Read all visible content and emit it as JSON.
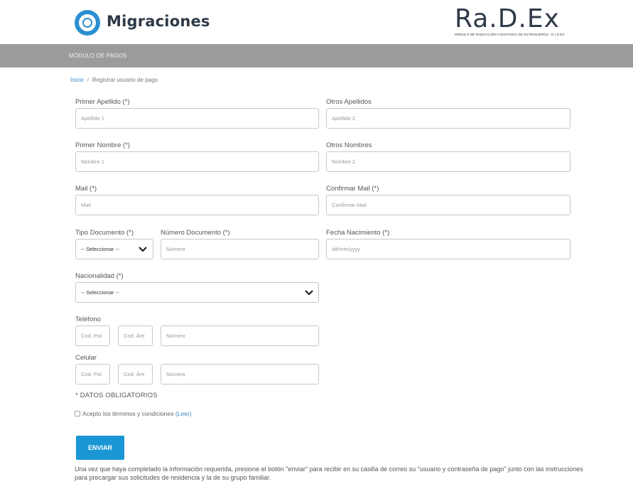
{
  "header": {
    "brand": "Migraciones",
    "radex_logo": "Ra.D.Ex",
    "radex_subtitle": "MÓDULO DE RADICACIÓN A DISTANCIA DE EXTRANJEROS - D.I.D.EX"
  },
  "section_bar": {
    "title": "MÓDULO DE PAGOS"
  },
  "breadcrumb": {
    "home": "Inicio",
    "separator": "/",
    "current": "Registrar usuario de pago"
  },
  "form": {
    "primer_apellido": {
      "label": "Primer Apellido (*)",
      "placeholder": "Apellido 1"
    },
    "otros_apellidos": {
      "label": "Otros Apellidos",
      "placeholder": "Apellido 2"
    },
    "primer_nombre": {
      "label": "Primer Nombre (*)",
      "placeholder": "Nombre 1"
    },
    "otros_nombres": {
      "label": "Otros Nombres",
      "placeholder": "Nombre 2"
    },
    "mail": {
      "label": "Mail (*)",
      "placeholder": "Mail"
    },
    "confirmar_mail": {
      "label": "Confirmar Mail (*)",
      "placeholder": "Confirmar Mail"
    },
    "tipo_documento": {
      "label": "Tipo Documento (*)",
      "value": "-- Seleccionar --"
    },
    "numero_documento": {
      "label": "Número Documento (*)",
      "placeholder": "Número"
    },
    "fecha_nacimiento": {
      "label": "Fecha Nacimiento (*)",
      "placeholder": "dd/mm/yyyy"
    },
    "nacionalidad": {
      "label": "Nacionalidad (*)",
      "value": "-- Seleccionar --"
    },
    "telefono": {
      "label": "Teléfono",
      "pais": "Cod. Paí",
      "area": "Cod. Áre",
      "numero": "Número"
    },
    "celular": {
      "label": "Celular",
      "pais": "Cod. Paí",
      "area": "Cod. Áre",
      "numero": "Número"
    },
    "required_note": "* DATOS OBLIGATORIOS",
    "terms": {
      "text": "Acepto los términos y condiciones",
      "link": "(Leer)"
    },
    "submit": "ENVIAR",
    "info": "Una vez que haya completado la información requerida, presione el botón \"enviar\" para recibir en su casilla de correo su \"usuario y contraseña de pago\" junto con las instrucciones para precargar sus solicitudes de residencia y la de su grupo familiar."
  },
  "colors": {
    "accent": "#1a96d4",
    "bar": "#9b9b9b",
    "brand_text": "#2e3a48",
    "link": "#3a88c6"
  }
}
